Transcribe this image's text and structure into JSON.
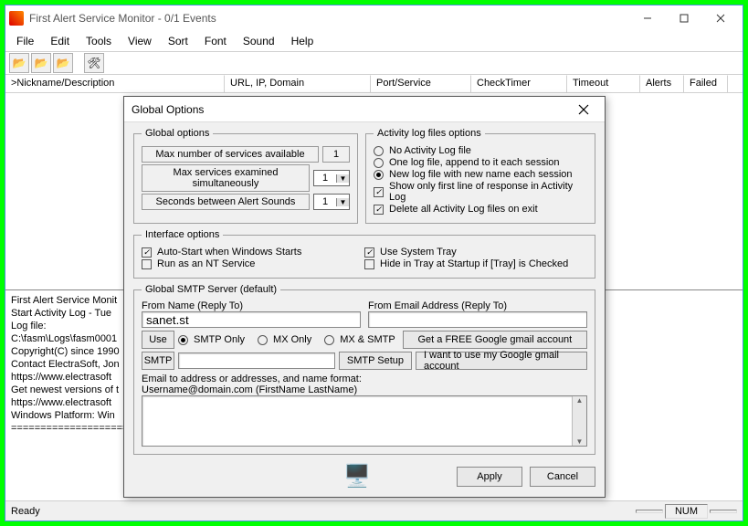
{
  "window": {
    "title": "First Alert Service Monitor - 0/1 Events",
    "menus": [
      "File",
      "Edit",
      "Tools",
      "View",
      "Sort",
      "Font",
      "Sound",
      "Help"
    ]
  },
  "columns": {
    "nick": ">Nickname/Description",
    "url": "URL, IP, Domain",
    "port": "Port/Service",
    "timer": "CheckTimer",
    "timeout": "Timeout",
    "alerts": "Alerts",
    "failed": "Failed"
  },
  "log": {
    "l1": "First Alert Service Monit",
    "l2": "",
    "l3": "Start Activity Log - Tue",
    "l4": "Log file:",
    "l5": "C:\\fasm\\Logs\\fasm0001",
    "l6": "Copyright(C) since 1990",
    "l7": "Contact ElectraSoft, Jon",
    "l8": "https://www.electrasoft",
    "l9": "Get newest versions of t",
    "l10": "https://www.electrasoft",
    "l11": "Windows Platform: Win",
    "l12": "======================"
  },
  "status": {
    "ready": "Ready",
    "num": "NUM"
  },
  "dialog": {
    "title": "Global Options",
    "go_legend": "Global options",
    "go_max_avail": "Max number of services available",
    "go_max_avail_val": "1",
    "go_max_sim": "Max services examined simultaneously",
    "go_max_sim_val": "1",
    "go_secs": "Seconds between Alert Sounds",
    "go_secs_val": "1",
    "log_legend": "Activity log files options",
    "log_r1": "No Activity Log file",
    "log_r2": "One log file, append to it each session",
    "log_r3": "New log file with new name each session",
    "log_c1": "Show only first line of response in Activity Log",
    "log_c2": "Delete all Activity Log files on exit",
    "if_legend": "Interface options",
    "if_c1": "Auto-Start when Windows Starts",
    "if_c2": "Run as an NT Service",
    "if_c3": "Use System Tray",
    "if_c4": "Hide in Tray at Startup if [Tray] is Checked",
    "smtp_legend": "Global SMTP Server (default)",
    "from_name": "From Name (Reply To)",
    "from_name_val": "sanet.st",
    "from_email": "From Email Address (Reply To)",
    "use": "Use",
    "r_smtp": "SMTP Only",
    "r_mx": "MX Only",
    "r_both": "MX & SMTP",
    "btn_free": "Get a FREE Google gmail account",
    "smtp_lbl": "SMTP",
    "btn_setup": "SMTP Setup",
    "btn_use": "I want to use my Google gmail account",
    "email_hint1": "Email to address or addresses, and name format:",
    "email_hint2": "Username@domain.com (FirstName LastName)",
    "apply": "Apply",
    "cancel": "Cancel"
  }
}
